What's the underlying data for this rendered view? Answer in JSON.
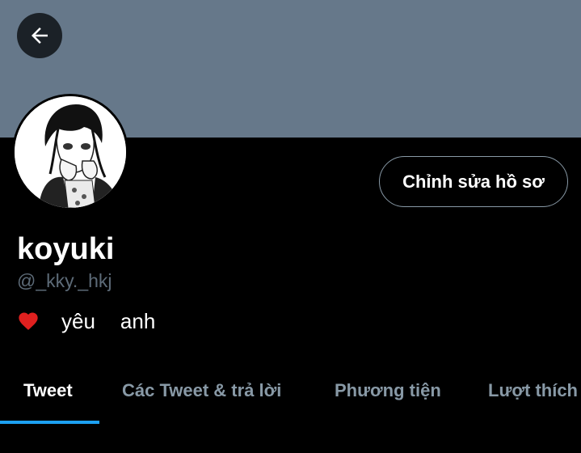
{
  "profile": {
    "name": "koyuki",
    "handle": "@_kky._hkj",
    "bio_word1": "yêu",
    "bio_word2": "anh",
    "edit_label": "Chỉnh sửa hồ sơ"
  },
  "tabs": [
    {
      "label": "Tweet",
      "active": true
    },
    {
      "label": "Các Tweet & trả lời",
      "active": false
    },
    {
      "label": "Phương tiện",
      "active": false
    },
    {
      "label": "Lượt thích",
      "active": false
    }
  ],
  "colors": {
    "banner": "#66788a",
    "accent": "#1da1f2",
    "muted_text": "#8899a6"
  },
  "icons": {
    "back": "arrow-left-icon",
    "bio_emoji": "red-heart-icon"
  }
}
